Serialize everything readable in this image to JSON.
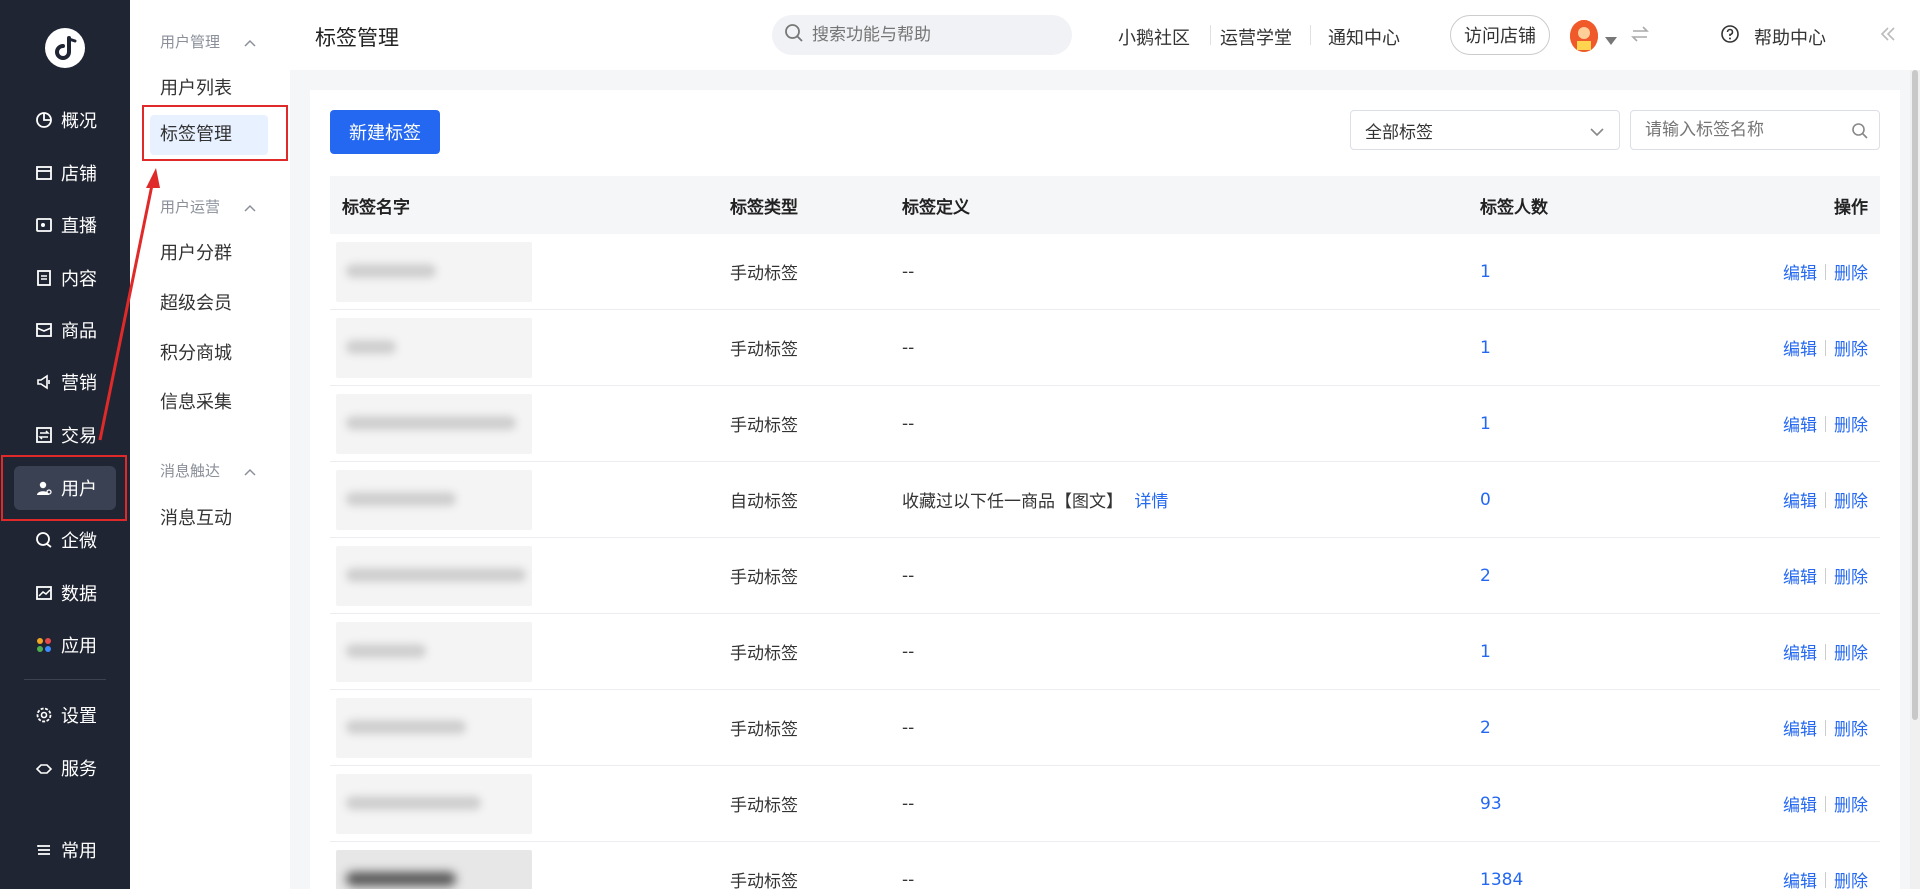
{
  "nav": {
    "items": [
      {
        "label": "概况",
        "icon": "pie-chart-icon"
      },
      {
        "label": "店铺",
        "icon": "store-icon"
      },
      {
        "label": "直播",
        "icon": "live-icon"
      },
      {
        "label": "内容",
        "icon": "document-icon"
      },
      {
        "label": "商品",
        "icon": "box-icon"
      },
      {
        "label": "营销",
        "icon": "megaphone-icon"
      },
      {
        "label": "交易",
        "icon": "exchange-icon"
      },
      {
        "label": "用户",
        "icon": "user-icon"
      },
      {
        "label": "企微",
        "icon": "chat-icon"
      },
      {
        "label": "数据",
        "icon": "chart-icon"
      },
      {
        "label": "应用",
        "icon": "apps-icon"
      },
      {
        "label": "设置",
        "icon": "gear-icon"
      },
      {
        "label": "服务",
        "icon": "handshake-icon"
      },
      {
        "label": "常用",
        "icon": "list-icon"
      }
    ],
    "active": "用户"
  },
  "subnav": {
    "groups": [
      {
        "title": "用户管理",
        "items": [
          "用户列表",
          "标签管理"
        ]
      },
      {
        "title": "用户运营",
        "items": [
          "用户分群",
          "超级会员",
          "积分商城",
          "信息采集"
        ]
      },
      {
        "title": "消息触达",
        "items": [
          "消息互动"
        ]
      }
    ],
    "active": "标签管理"
  },
  "header": {
    "title": "标签管理",
    "search_placeholder": "搜索功能与帮助",
    "links": [
      "小鹅社区",
      "运营学堂",
      "通知中心"
    ],
    "visit_store": "访问店铺",
    "help": "帮助中心"
  },
  "toolbar": {
    "new_button": "新建标签",
    "filter_value": "全部标签",
    "name_placeholder": "请输入标签名称"
  },
  "table": {
    "columns": [
      "标签名字",
      "标签类型",
      "标签定义",
      "标签人数",
      "操作"
    ],
    "rows": [
      {
        "name": "",
        "type": "手动标签",
        "definition": "--",
        "detail": "",
        "count": "1"
      },
      {
        "name": "",
        "type": "手动标签",
        "definition": "--",
        "detail": "",
        "count": "1"
      },
      {
        "name": "",
        "type": "手动标签",
        "definition": "--",
        "detail": "",
        "count": "1"
      },
      {
        "name": "",
        "type": "自动标签",
        "definition": "收藏过以下任一商品【图文】",
        "detail": "详情",
        "count": "0"
      },
      {
        "name": "",
        "type": "手动标签",
        "definition": "--",
        "detail": "",
        "count": "2"
      },
      {
        "name": "",
        "type": "手动标签",
        "definition": "--",
        "detail": "",
        "count": "1"
      },
      {
        "name": "",
        "type": "手动标签",
        "definition": "--",
        "detail": "",
        "count": "2"
      },
      {
        "name": "",
        "type": "手动标签",
        "definition": "--",
        "detail": "",
        "count": "93"
      },
      {
        "name": "",
        "type": "手动标签",
        "definition": "--",
        "detail": "",
        "count": "1384"
      }
    ],
    "ops": {
      "edit": "编辑",
      "delete": "删除"
    }
  },
  "colors": {
    "primary": "#2468f2",
    "nav_bg": "#1f2532",
    "highlight_red": "#e02a2a"
  }
}
